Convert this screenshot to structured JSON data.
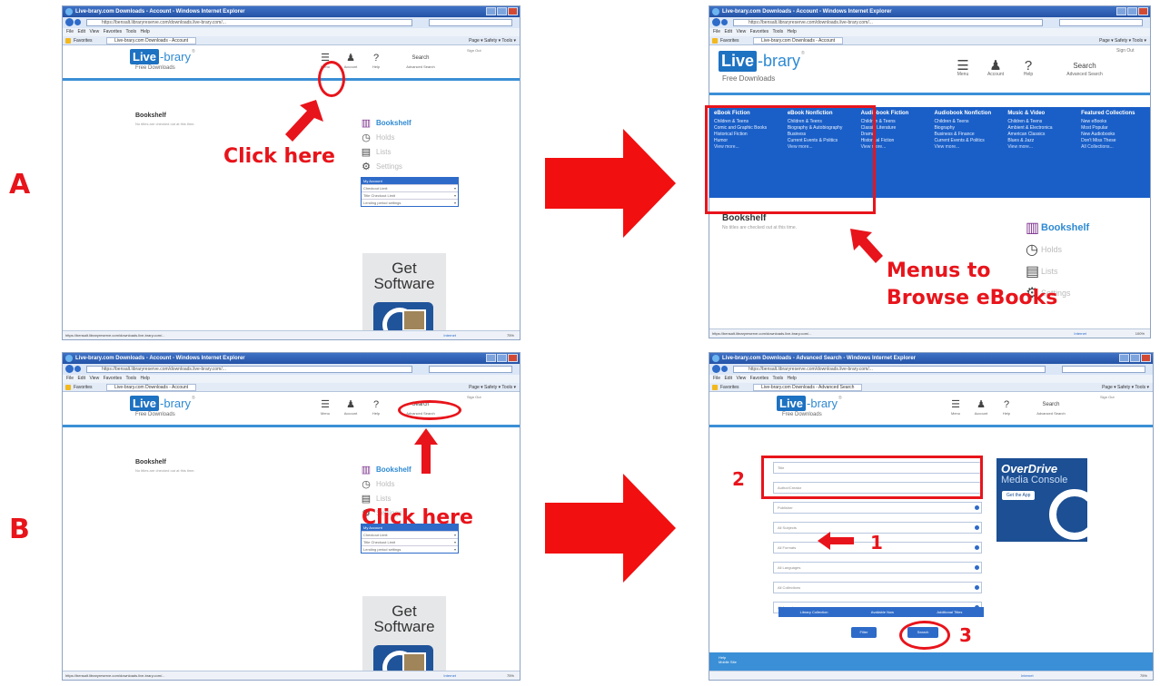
{
  "rows": {
    "a": "A",
    "b": "B"
  },
  "browser": {
    "window_title_account": "Live-brary.com Downloads - Account - Windows Internet Explorer",
    "window_title_search": "Live-brary.com Downloads - Advanced Search - Windows Internet Explorer",
    "url": "https://bensalt.libraryreserve.com/downloads.live-brary.com/...",
    "menu_bar": "File Edit View Favorites Tools Help",
    "favorites": "Favorites",
    "tab_account": "Live-brary.com Downloads - Account",
    "tab_search": "Live-brary.com Downloads - Advanced Search",
    "toolbar_right": "Page ▾ Safety ▾ Tools ▾",
    "status_url": "https://bensalt.libraryreserve.com/downloads.live-brary.com/...",
    "status_zone": "Internet",
    "zoom": "75%",
    "zoom_b": "100%"
  },
  "site": {
    "logo_live": "Live",
    "logo_brary": "-brary",
    "logo_tm": "®",
    "subtitle": "Free Downloads",
    "sign_out": "Sign Out",
    "menu_label": "Menu",
    "account_label": "Account",
    "help_label": "Help",
    "search_label": "Search",
    "advanced_search": "Advanced Search"
  },
  "bookshelf": {
    "heading": "Bookshelf",
    "empty_text": "No titles are checked out at this time."
  },
  "sidebar": {
    "items": [
      {
        "label": "Bookshelf",
        "icon": "books-icon"
      },
      {
        "label": "Holds",
        "icon": "stopwatch-icon"
      },
      {
        "label": "Lists",
        "icon": "clipboard-icon"
      },
      {
        "label": "Settings",
        "icon": "gears-icon"
      }
    ],
    "account_header": "My Account",
    "account_rows": [
      "Checkout Limit",
      "Title Checkout Limit",
      "Lending period settings"
    ]
  },
  "get_software": {
    "line1": "Get",
    "line2": "Software"
  },
  "megamenu": {
    "columns": [
      {
        "heading": "eBook Fiction",
        "items": [
          "Children & Teens",
          "Comic and Graphic Books",
          "Historical Fiction",
          "Humor",
          "View more..."
        ]
      },
      {
        "heading": "eBook Nonfiction",
        "items": [
          "Children & Teens",
          "Biography & Autobiography",
          "Business",
          "Current Events & Politics",
          "View more..."
        ]
      },
      {
        "heading": "Audiobook Fiction",
        "items": [
          "Children & Teens",
          "Classic Literature",
          "Drama",
          "Historical Fiction",
          "View more..."
        ]
      },
      {
        "heading": "Audiobook Nonfiction",
        "items": [
          "Children & Teens",
          "Biography",
          "Business & Finance",
          "Current Events & Politics",
          "View more..."
        ]
      },
      {
        "heading": "Music & Video",
        "items": [
          "Children & Teens",
          "Ambient & Electronica",
          "American Classics",
          "Blues & Jazz",
          "View more..."
        ]
      },
      {
        "heading": "Featured Collections",
        "items": [
          "New eBooks",
          "Most Popular",
          "New Audiobooks",
          "Don't Miss These",
          "All Collections..."
        ]
      }
    ]
  },
  "advanced": {
    "fields": [
      "Title",
      "Author/Creator",
      "Publisher",
      "All Subjects",
      "All Formats",
      "All Languages",
      "All Collections",
      "All Awards"
    ],
    "facets": [
      "Library Collection",
      "Available Now",
      "Additional Titles"
    ],
    "filter_label": "Filter",
    "search_label": "Search",
    "od_brand": "OverDrive",
    "od_sub": "Media Console",
    "od_app": "Get the App",
    "footer_link": "Help",
    "footer_link2": "Mobile Site"
  },
  "annotations": {
    "click_here": "Click here",
    "menus_line1": "Menus to",
    "menus_line2": "Browse eBooks",
    "n1": "1",
    "n2": "2",
    "n3": "3"
  },
  "colors": {
    "annotation": "#e8141b",
    "link_blue": "#1a5fc7"
  }
}
